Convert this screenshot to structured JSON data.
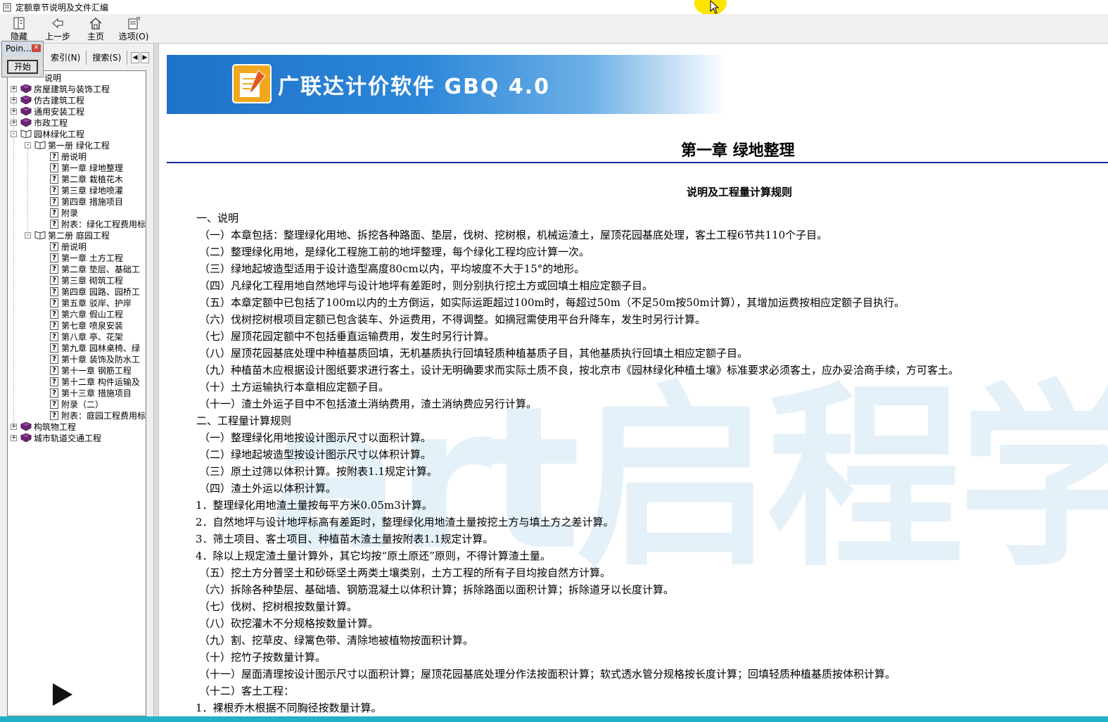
{
  "window": {
    "title": "定额章节说明及文件汇编"
  },
  "toolbar": {
    "hide": "隐藏",
    "back": "上一步",
    "home": "主页",
    "options": "选项(O)"
  },
  "pointer_popup": {
    "title": "Poin...",
    "start": "开始"
  },
  "tabs": {
    "index": "索引(N)",
    "search": "搜索(S)"
  },
  "tree": {
    "top_partial": "说明",
    "items": [
      {
        "label": "房屋建筑与装饰工程",
        "expander": "+"
      },
      {
        "label": "仿古建筑工程",
        "expander": "+"
      },
      {
        "label": "通用安装工程",
        "expander": "+"
      },
      {
        "label": "市政工程",
        "expander": "+"
      },
      {
        "label": "园林绿化工程",
        "expander": "-"
      },
      {
        "label": "第一册  绿化工程",
        "expander": "-"
      },
      {
        "label": "册说明"
      },
      {
        "label": "第一章  绿地整理"
      },
      {
        "label": "第二章  栽植花木"
      },
      {
        "label": "第三章  绿地喷灌"
      },
      {
        "label": "第四章  措施项目"
      },
      {
        "label": "附录"
      },
      {
        "label": "附表：绿化工程费用标"
      },
      {
        "label": "第二册  庭园工程",
        "expander": "-"
      },
      {
        "label": "册说明"
      },
      {
        "label": "第一章  土方工程"
      },
      {
        "label": "第二章  垫层、基础工"
      },
      {
        "label": "第三章  砌筑工程"
      },
      {
        "label": "第四章  园路、园桥工"
      },
      {
        "label": "第五章  驳岸、护岸"
      },
      {
        "label": "第六章  假山工程"
      },
      {
        "label": "第七章  喷泉安装"
      },
      {
        "label": "第八章  亭、花架"
      },
      {
        "label": "第九章  园林桌椅、绿"
      },
      {
        "label": "第十章  装饰及防水工"
      },
      {
        "label": "第十一章  钢筋工程"
      },
      {
        "label": "第十二章  构件运输及"
      },
      {
        "label": "第十三章  措施项目"
      },
      {
        "label": "附录（二）"
      },
      {
        "label": "附表：庭园工程费用标"
      },
      {
        "label": "构筑物工程",
        "expander": "+"
      },
      {
        "label": "城市轨道交通工程",
        "expander": "+"
      }
    ]
  },
  "banner": {
    "text": "广联达计价软件 GBQ 4.0"
  },
  "document": {
    "chapter_title": "第一章  绿地整理",
    "subtitle": "说明及工程量计算规则",
    "lines": [
      "一、说明",
      "（一）本章包括：整理绿化用地、拆挖各种路面、垫层，伐树、挖树根，机械运渣土，屋顶花园基底处理，客土工程6节共110个子目。",
      "（二）整理绿化用地，是绿化工程施工前的地坪整理，每个绿化工程均应计算一次。",
      "（三）绿地起坡造型适用于设计造型高度80cm以内，平均坡度不大于15°的地形。",
      "（四）凡绿化工程用地自然地坪与设计地坪有差距时，则分别执行挖土方或回填土相应定额子目。",
      "（五）本章定额中已包括了100m以内的土方倒运，如实际运距超过100m时，每超过50m（不足50m按50m计算），其增加运费按相应定额子目执行。",
      "（六）伐树挖树根项目定额已包含装车、外运费用，不得调整。如摘冠需使用平台升降车，发生时另行计算。",
      "（七）屋顶花园定额中不包括垂直运输费用，发生时另行计算。",
      "（八）屋顶花园基底处理中种植基质回填，无机基质执行回填轻质种植基质子目，其他基质执行回填土相应定额子目。",
      "（九）种植苗木应根据设计图纸要求进行客土，设计无明确要求而实际土质不良，按北京市《园林绿化种植土壤》标准要求必须客土，应办妥洽商手续，方可客土。",
      "（十）土方运输执行本章相应定额子目。",
      "（十一）渣土外运子目中不包括渣土消纳费用，渣土消纳费应另行计算。",
      "二、工程量计算规则",
      "（一）整理绿化用地按设计图示尺寸以面积计算。",
      "（二）绿地起坡造型按设计图示尺寸以体积计算。",
      "（三）原土过筛以体积计算。按附表1.1规定计算。",
      "（四）渣土外运以体积计算。",
      "1．整理绿化用地渣土量按每平方米0.05m3计算。",
      "2．自然地坪与设计地坪标高有差距时，整理绿化用地渣土量按挖土方与填土方之差计算。",
      "3．筛土项目、客土项目、种植苗木渣土量按附表1.1规定计算。",
      "4．除以上规定渣土量计算外，其它均按“原土原还”原则，不得计算渣土量。",
      "（五）挖土方分普坚土和砂砾坚土两类土壤类别，土方工程的所有子目均按自然方计算。",
      "（六）拆除各种垫层、基础墙、钢筋混凝土以体积计算；拆除路面以面积计算；拆除道牙以长度计算。",
      "（七）伐树、挖树根按数量计算。",
      "（八）砍挖灌木不分规格按数量计算。",
      "（九）割、挖草皮、绿篱色带、清除地被植物按面积计算。",
      "（十）挖竹子按数量计算。",
      "（十一）屋面清理按设计图示尺寸以面积计算；屋顶花园基底处理分作法按面积计算；软式透水管分规格按长度计算；回填轻质种植基质按体积计算。",
      "（十二）客土工程：",
      "1．裸根乔木根据不同胸径按数量计算。"
    ]
  },
  "watermark": {
    "text": "art启程学"
  },
  "colors": {
    "accent_blue": "#1e73c8",
    "rule": "#1a2a9a",
    "bottom_bar": "#21b2c8",
    "cursor_highlight": "#ffe400"
  }
}
